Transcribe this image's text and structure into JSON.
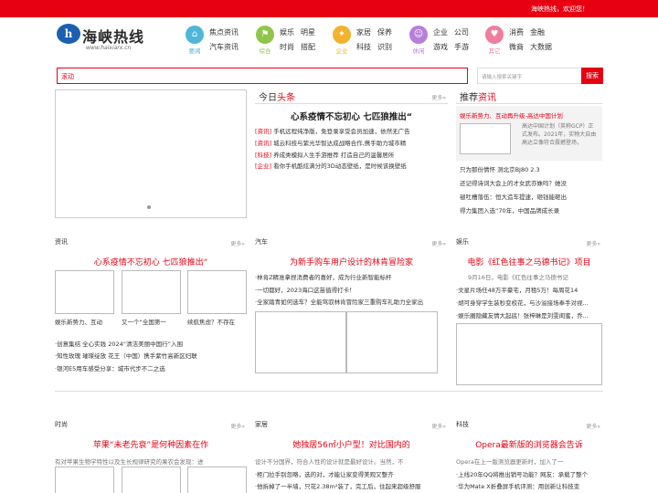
{
  "topbar": {
    "welcome": "海峡热线，欢迎您！"
  },
  "logo": {
    "mark": "h",
    "name": "海峡热线",
    "url": "www.haixiarx.cn"
  },
  "nav": [
    {
      "tag": "要闻",
      "color": "#4fb6d8",
      "icon": "⌂",
      "row1": [
        "焦点资讯"
      ],
      "row2": [
        "汽车资讯"
      ]
    },
    {
      "tag": "综合",
      "color": "#8fc649",
      "icon": "⚑",
      "row1": [
        "娱乐",
        "明星"
      ],
      "row2": [
        "时尚",
        "搭配"
      ]
    },
    {
      "tag": "企业",
      "color": "#f4b12e",
      "icon": "✦",
      "row1": [
        "家居",
        "保养"
      ],
      "row2": [
        "科技",
        "识别"
      ]
    },
    {
      "tag": "休闲",
      "color": "#b77fd8",
      "icon": "☺",
      "row1": [
        "企业",
        "公司"
      ],
      "row2": [
        "游戏",
        "手游"
      ]
    },
    {
      "tag": "其它",
      "color": "#ef7d9e",
      "icon": "♥",
      "row1": [
        "消费",
        "金融"
      ],
      "row2": [
        "微商",
        "大数据"
      ]
    }
  ],
  "search": {
    "tag": "滚动",
    "placeholder": "请输入搜索关键字",
    "button": "搜索"
  },
  "today": {
    "title_a": "今日",
    "title_b": "头条",
    "more": "更多»",
    "headline": "心系疫情不忘初心 七匹狼推出“",
    "items": [
      {
        "cat": "[资讯]",
        "text": "手机远程纯净版，免登录享受会员加速，依然无广告"
      },
      {
        "cat": "[资讯]",
        "text": "城云科技与紫光华智达成战略合作,携手助力城市精"
      },
      {
        "cat": "[科技]",
        "text": "养成类模拟人生手游推荐 打造自己的温馨居所"
      },
      {
        "cat": "[企业]",
        "text": "看你手机酷炫满分的3D动态壁纸，是时候该换壁纸"
      }
    ]
  },
  "recommend": {
    "title_a": "推荐",
    "title_b": "资讯",
    "feature_title": "娱乐新势力、互动再升级-高达中国计划",
    "feature_desc": "高达中国计划（英称GCP）正式发布。2021年，实物大自由高达立像符合震撼登场，",
    "items": [
      "只为那份情怀 测北京BJ80 2.3",
      "还记得诗词大会上的才女武亦姝吗？她没",
      "褪吐槽落伍：恒大造车提速，砸钱能砸出",
      "得力集团入选“70年，中国品牌成长录"
    ]
  },
  "news": {
    "label": "资讯",
    "more": "更多»",
    "headline": "心系疫情不忘初心 七匹狼推出“",
    "captions": [
      "娱乐新势力、互动",
      "又一个“全国第一",
      "续航焦虑？不存在"
    ],
    "items": [
      "·创意集结 全心实践 2024“清洁美丽中国行”入围",
      "·知性玫瑰 璀璨绽放 花王（中国）携手紫竹高新区妇联",
      "·银河E5用车感受分享：城市代步不二之选"
    ]
  },
  "cars": {
    "label": "汽车",
    "more": "更多»",
    "headline": "为新手购车用户设计的林肯冒险家",
    "items": [
      "·林肯Z精准拿捏消费者的喜好，成为行业新智能标杆",
      "·一切都好，2023海口这苗值得打卡！",
      "·全家踏青如何选车？全能驾驭林肯冒险家三重购车礼助力全家出"
    ]
  },
  "ent": {
    "label": "娱乐",
    "more": "更多»",
    "headline": "电影《红色往事之马德书记》项目",
    "date_line": "9月16日，电影《红色往事之马德书记",
    "items": [
      "·文星片场任48万平豪宅，月租5万！每周花14",
      "·胡可身穿学生装秒变校花，与沙溢接场奉手对视...",
      "·娱乐圈隐藏友情大起底！张梓琳是刘雯闺蜜，乔..."
    ]
  },
  "fashion": {
    "label": "时尚",
    "more": "更多»",
    "headline": "苹果“未老先衰”是何种因素在作",
    "desc": "有对苹果生物学特性以及生长规律研究的果农会发现：进"
  },
  "home": {
    "label": "家居",
    "more": "更多»",
    "headline": "她独居56㎡小户型！对比国内的",
    "desc": "设计不分国界，符合人性的设计就是最好设计。当然，不",
    "items": [
      "·柜门拉手别忽略，选的对，才能让家变得美观又整齐",
      "·他拆掉了一半墙，只花2.38m²装了，完工后，住起来超级舒服"
    ]
  },
  "tech": {
    "label": "科技",
    "more": "更多»",
    "headline": "Opera最新版的浏览器会告诉",
    "desc": "Opera在上一版测览器更新时，加入了一",
    "items": [
      "·上线20年QQ将推出销号功能？网友：承载了整个",
      "·华为Mate X折叠屏手机评测：用创新让科技变"
    ]
  }
}
